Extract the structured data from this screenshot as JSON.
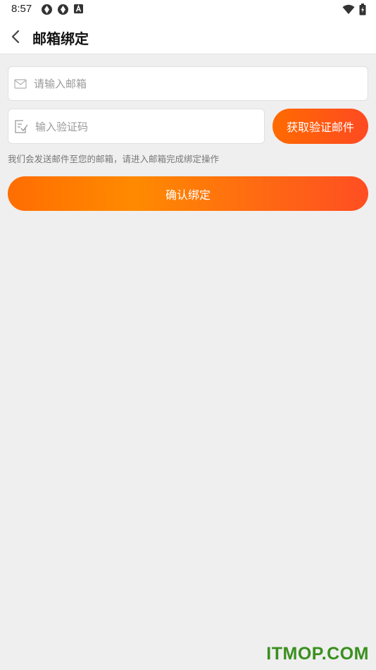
{
  "status_bar": {
    "time": "8:57",
    "icons": [
      "app-icon",
      "app-icon",
      "font-icon"
    ],
    "right_icons": [
      "wifi-icon",
      "battery-icon"
    ]
  },
  "nav": {
    "back_icon": "chevron-left-icon",
    "title": "邮箱绑定"
  },
  "form": {
    "email": {
      "icon": "mail-icon",
      "placeholder": "请输入邮箱",
      "value": ""
    },
    "code": {
      "icon": "edit-check-icon",
      "placeholder": "输入验证码",
      "value": ""
    },
    "get_code_label": "获取验证邮件",
    "hint": "我们会发送邮件至您的邮箱，请进入邮箱完成绑定操作",
    "confirm_label": "确认绑定"
  },
  "colors": {
    "accent_start": "#ff6a00",
    "accent_end": "#ff4a22",
    "background": "#efefef"
  },
  "watermark": "ITMOP.COM"
}
